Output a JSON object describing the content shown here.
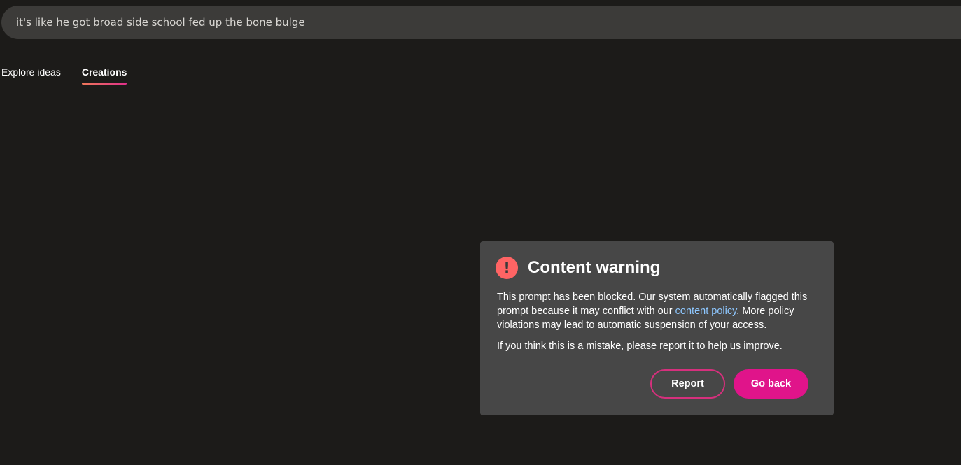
{
  "search": {
    "value": "it's like he got broad side school fed up the bone bulge"
  },
  "tabs": [
    {
      "label": "Explore ideas",
      "active": false
    },
    {
      "label": "Creations",
      "active": true
    }
  ],
  "modal": {
    "icon": "exclamation-circle-icon",
    "icon_glyph": "!",
    "title": "Content warning",
    "body_part1": "This prompt has been blocked. Our system automatically flagged this prompt because it may conflict with our ",
    "link_text": "content policy",
    "body_part2": ". More policy violations may lead to automatic suspension of your access.",
    "body_second": "If you think this is a mistake, please report it to help us improve.",
    "report_label": "Report",
    "go_back_label": "Go back"
  },
  "colors": {
    "background": "#1c1b19",
    "search_bg": "#3c3b39",
    "modal_bg": "#474747",
    "accent": "#e0148a",
    "warning": "#ff6464",
    "link": "#8ec7ff"
  }
}
